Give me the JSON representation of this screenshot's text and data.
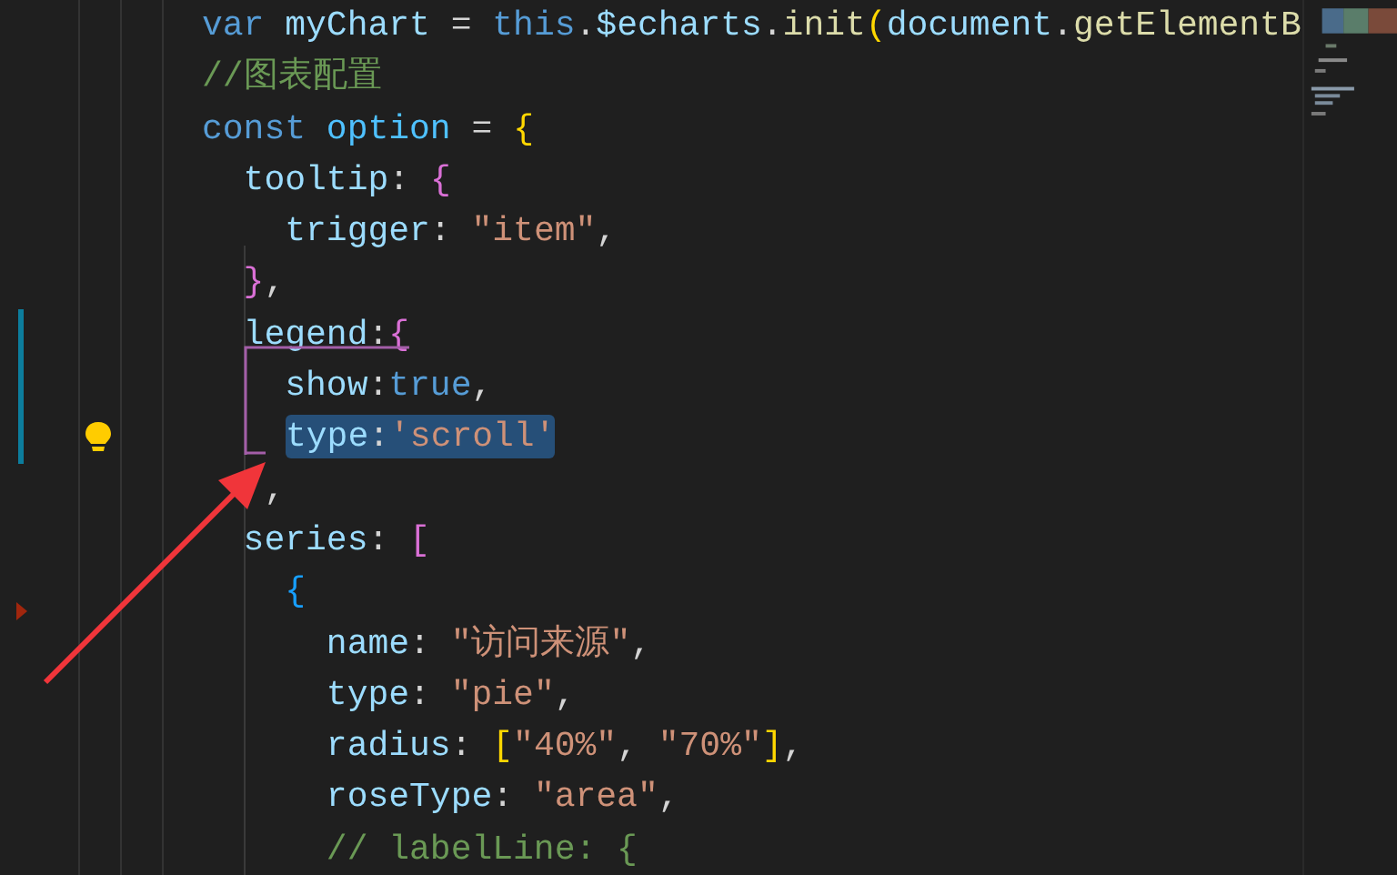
{
  "editor": {
    "lines": [
      {
        "selected": false,
        "modified": false,
        "lightbulb": false,
        "deleted_marker": false,
        "tokens": [
          {
            "kind": "keyword",
            "text": "var"
          },
          {
            "kind": "variable",
            "text": " myChart"
          },
          {
            "kind": "punct",
            "text": " = "
          },
          {
            "kind": "keyword",
            "text": "this"
          },
          {
            "kind": "punct",
            "text": "."
          },
          {
            "kind": "variable",
            "text": "$echarts"
          },
          {
            "kind": "punct",
            "text": "."
          },
          {
            "kind": "function",
            "text": "init"
          },
          {
            "kind": "bracket1",
            "text": "("
          },
          {
            "kind": "variable",
            "text": "document"
          },
          {
            "kind": "punct",
            "text": "."
          },
          {
            "kind": "function",
            "text": "getElementB"
          }
        ]
      },
      {
        "selected": false,
        "modified": false,
        "lightbulb": false,
        "deleted_marker": false,
        "tokens": [
          {
            "kind": "comment",
            "text": "//图表配置"
          }
        ]
      },
      {
        "selected": false,
        "modified": false,
        "lightbulb": false,
        "deleted_marker": false,
        "tokens": [
          {
            "kind": "keyword",
            "text": "const"
          },
          {
            "kind": "constant",
            "text": " option"
          },
          {
            "kind": "punct",
            "text": " = "
          },
          {
            "kind": "bracket1",
            "text": "{"
          }
        ]
      },
      {
        "selected": false,
        "modified": false,
        "lightbulb": false,
        "deleted_marker": false,
        "tokens": [
          {
            "kind": "property",
            "text": "  tooltip"
          },
          {
            "kind": "punct",
            "text": ": "
          },
          {
            "kind": "bracket2",
            "text": "{"
          }
        ]
      },
      {
        "selected": false,
        "modified": false,
        "lightbulb": false,
        "deleted_marker": false,
        "tokens": [
          {
            "kind": "property",
            "text": "    trigger"
          },
          {
            "kind": "punct",
            "text": ": "
          },
          {
            "kind": "string",
            "text": "\"item\""
          },
          {
            "kind": "punct",
            "text": ","
          }
        ]
      },
      {
        "selected": false,
        "modified": false,
        "lightbulb": false,
        "deleted_marker": false,
        "tokens": [
          {
            "kind": "bracket2",
            "text": "  }"
          },
          {
            "kind": "punct",
            "text": ","
          }
        ]
      },
      {
        "selected": false,
        "modified": true,
        "lightbulb": false,
        "deleted_marker": false,
        "tokens": [
          {
            "kind": "property",
            "text": "  legend"
          },
          {
            "kind": "punct",
            "text": ":"
          },
          {
            "kind": "bracket2",
            "text": "{"
          }
        ]
      },
      {
        "selected": false,
        "modified": true,
        "lightbulb": false,
        "deleted_marker": false,
        "tokens": [
          {
            "kind": "property",
            "text": "    show"
          },
          {
            "kind": "punct",
            "text": ":"
          },
          {
            "kind": "keyword",
            "text": "true"
          },
          {
            "kind": "punct",
            "text": ","
          }
        ]
      },
      {
        "selected": true,
        "modified": true,
        "lightbulb": true,
        "deleted_marker": false,
        "tokens": [
          {
            "kind": "property",
            "text": "type"
          },
          {
            "kind": "punct",
            "text": ":"
          },
          {
            "kind": "string",
            "text": "'scroll'"
          }
        ]
      },
      {
        "selected": false,
        "modified": false,
        "lightbulb": false,
        "deleted_marker": false,
        "tokens": [
          {
            "kind": "punct",
            "text": "   ,"
          }
        ]
      },
      {
        "selected": false,
        "modified": false,
        "lightbulb": false,
        "deleted_marker": false,
        "tokens": [
          {
            "kind": "property",
            "text": "  series"
          },
          {
            "kind": "punct",
            "text": ": "
          },
          {
            "kind": "bracket2",
            "text": "["
          }
        ]
      },
      {
        "selected": false,
        "modified": false,
        "lightbulb": false,
        "deleted_marker": true,
        "tokens": [
          {
            "kind": "bracket3",
            "text": "    {"
          }
        ]
      },
      {
        "selected": false,
        "modified": false,
        "lightbulb": false,
        "deleted_marker": false,
        "tokens": [
          {
            "kind": "property",
            "text": "      name"
          },
          {
            "kind": "punct",
            "text": ": "
          },
          {
            "kind": "string",
            "text": "\"访问来源\""
          },
          {
            "kind": "punct",
            "text": ","
          }
        ]
      },
      {
        "selected": false,
        "modified": false,
        "lightbulb": false,
        "deleted_marker": false,
        "tokens": [
          {
            "kind": "property",
            "text": "      type"
          },
          {
            "kind": "punct",
            "text": ": "
          },
          {
            "kind": "string",
            "text": "\"pie\""
          },
          {
            "kind": "punct",
            "text": ","
          }
        ]
      },
      {
        "selected": false,
        "modified": false,
        "lightbulb": false,
        "deleted_marker": false,
        "tokens": [
          {
            "kind": "property",
            "text": "      radius"
          },
          {
            "kind": "punct",
            "text": ": "
          },
          {
            "kind": "bracket1",
            "text": "["
          },
          {
            "kind": "string",
            "text": "\"40%\""
          },
          {
            "kind": "punct",
            "text": ", "
          },
          {
            "kind": "string",
            "text": "\"70%\""
          },
          {
            "kind": "bracket1",
            "text": "]"
          },
          {
            "kind": "punct",
            "text": ","
          }
        ]
      },
      {
        "selected": false,
        "modified": false,
        "lightbulb": false,
        "deleted_marker": false,
        "tokens": [
          {
            "kind": "property",
            "text": "      roseType"
          },
          {
            "kind": "punct",
            "text": ": "
          },
          {
            "kind": "string",
            "text": "\"area\""
          },
          {
            "kind": "punct",
            "text": ","
          }
        ]
      },
      {
        "selected": false,
        "modified": false,
        "lightbulb": false,
        "deleted_marker": false,
        "tokens": [
          {
            "kind": "comment",
            "text": "      // labelLine: {"
          }
        ]
      }
    ]
  }
}
